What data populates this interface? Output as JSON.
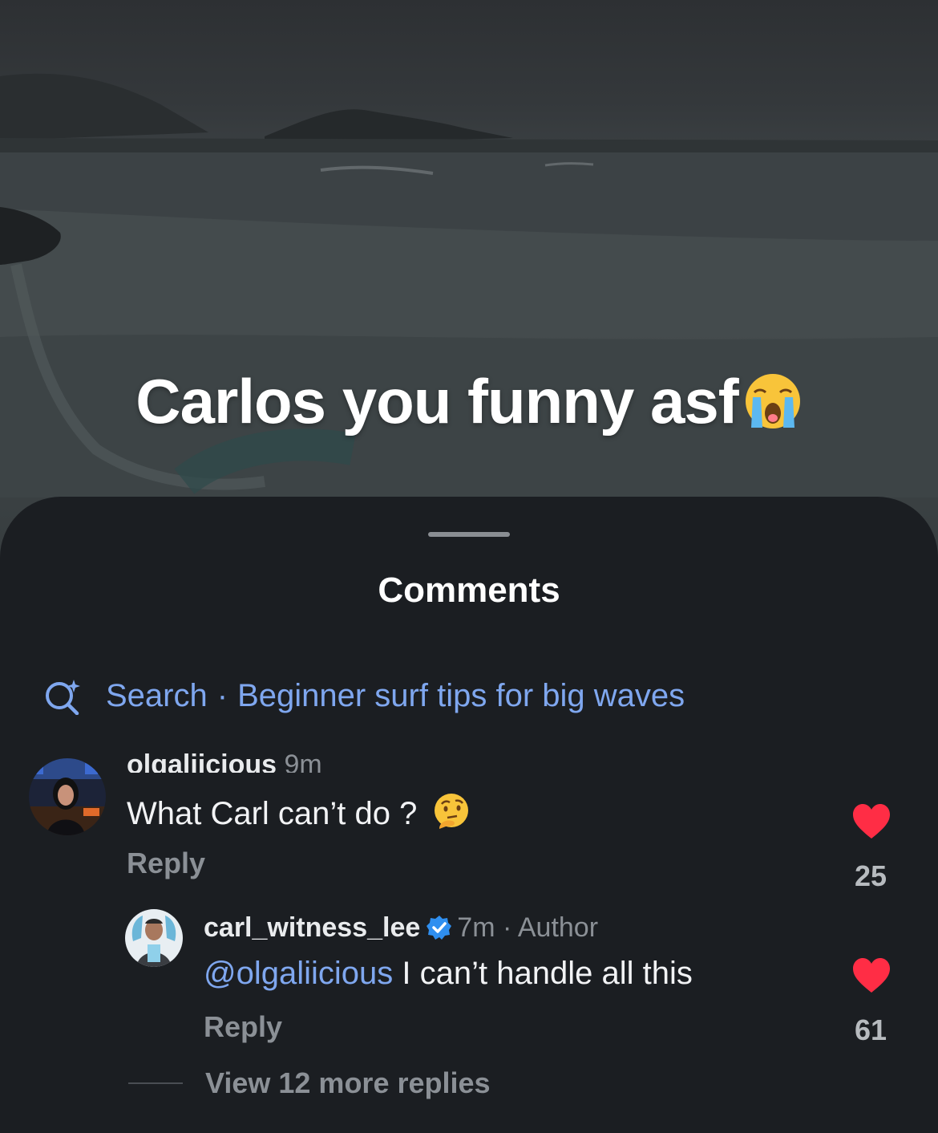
{
  "video": {
    "caption": "Carlos you funny asf",
    "caption_emoji": "loudly-crying-face-emoji"
  },
  "sheet": {
    "title": "Comments",
    "search": {
      "label": "Search",
      "separator": "·",
      "suggestion": "Beginner surf tips for big waves"
    }
  },
  "comments": [
    {
      "username": "olgaliicious",
      "time": "9m",
      "text": "What Carl can’t do ?",
      "emoji": "thinking-face-emoji",
      "reply_label": "Reply",
      "likes": "25",
      "liked": true
    },
    {
      "username": "carl_witness_lee",
      "verified": true,
      "time": "7m · Author",
      "mention": "@olgaliicious",
      "text": " I can’t handle all this",
      "reply_label": "Reply",
      "likes": "61",
      "liked": true
    }
  ],
  "view_more": "View 12 more replies",
  "colors": {
    "accent_blue": "#7fa7ef",
    "like_red": "#ff2d45",
    "sheet_bg": "#1b1e22",
    "verified_blue": "#2f8ff0"
  }
}
